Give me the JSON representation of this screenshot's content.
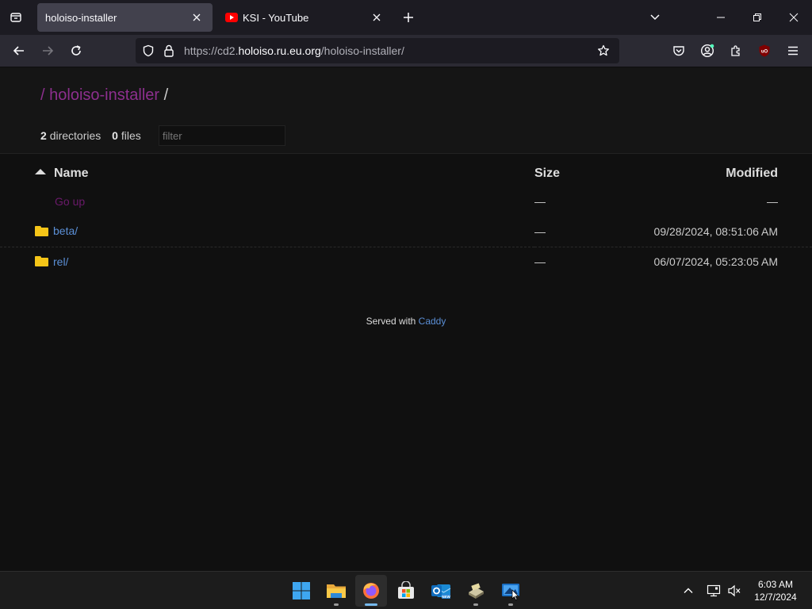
{
  "browser": {
    "tabs": [
      {
        "title": "holoiso-installer",
        "active": true
      },
      {
        "title": "KSI - YouTube",
        "active": false
      }
    ],
    "url": {
      "prefix": "https://cd2.",
      "host": "holoiso.ru.eu.org",
      "path": "/holoiso-installer/"
    }
  },
  "listing": {
    "breadcrumb": {
      "separator": "/",
      "current": "holoiso-installer",
      "trail": "/"
    },
    "summary": {
      "dir_count": "2",
      "dir_label": "directories",
      "file_count": "0",
      "file_label": "files"
    },
    "filter_placeholder": "filter",
    "columns": {
      "name": "Name",
      "size": "Size",
      "modified": "Modified"
    },
    "go_up": {
      "label": "Go up",
      "size": "—",
      "modified": "—"
    },
    "entries": [
      {
        "name": "beta/",
        "size": "—",
        "modified": "09/28/2024, 08:51:06 AM",
        "icon": "folder-icon"
      },
      {
        "name": "rel/",
        "size": "—",
        "modified": "06/07/2024, 05:23:05 AM",
        "icon": "folder-icon"
      }
    ],
    "footer": {
      "prefix": "Served with",
      "link": "Caddy"
    }
  },
  "taskbar": {
    "apps": [
      "start-icon",
      "file-explorer-icon",
      "firefox-icon",
      "microsoft-store-icon",
      "outlook-icon",
      "drive-app-icon",
      "remote-desktop-icon"
    ],
    "clock": {
      "time": "6:03 AM",
      "date": "12/7/2024"
    }
  },
  "colors": {
    "accent_link": "#5b8fd6",
    "breadcrumb_link": "#8d2f8e",
    "folder": "#f5c518"
  }
}
